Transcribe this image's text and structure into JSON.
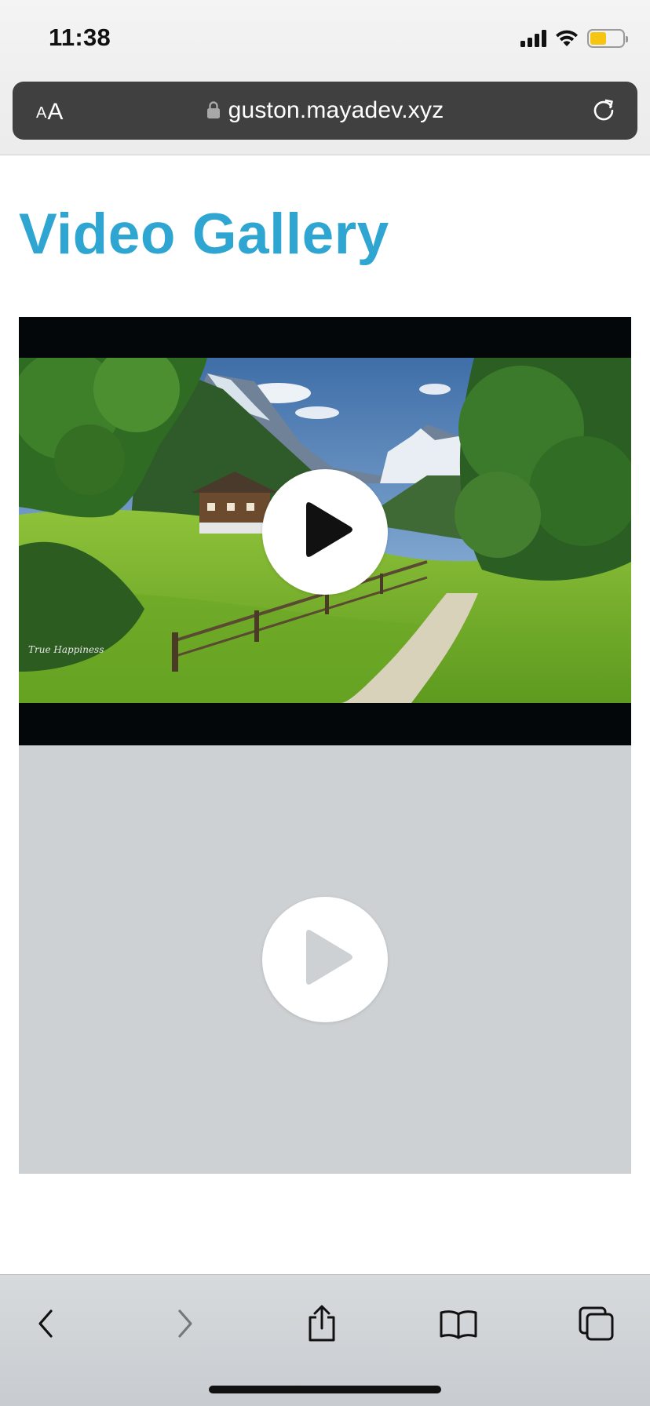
{
  "status_bar": {
    "time": "11:38",
    "battery_level": 0.5,
    "battery_color": "#f5c511",
    "icons": [
      "cellular-signal-icon",
      "wifi-icon",
      "battery-icon"
    ]
  },
  "browser": {
    "text_size_button": {
      "small": "A",
      "large": "A"
    },
    "url": "guston.mayadev.xyz",
    "icons": [
      "lock-icon",
      "reload-icon"
    ]
  },
  "page": {
    "title": "Video Gallery",
    "title_color": "#2fa6d1",
    "videos": [
      {
        "thumbnail": "mountain-valley-thumbnail",
        "thumbnail_watermark": "True Happiness",
        "play_icon": "play-icon"
      },
      {
        "thumbnail": null,
        "placeholder_color": "#cdd1d4",
        "play_icon": "play-icon"
      }
    ]
  },
  "toolbar": {
    "items": [
      "back-icon",
      "forward-icon",
      "share-icon",
      "bookmarks-icon",
      "tabs-icon"
    ],
    "forward_enabled": false
  }
}
